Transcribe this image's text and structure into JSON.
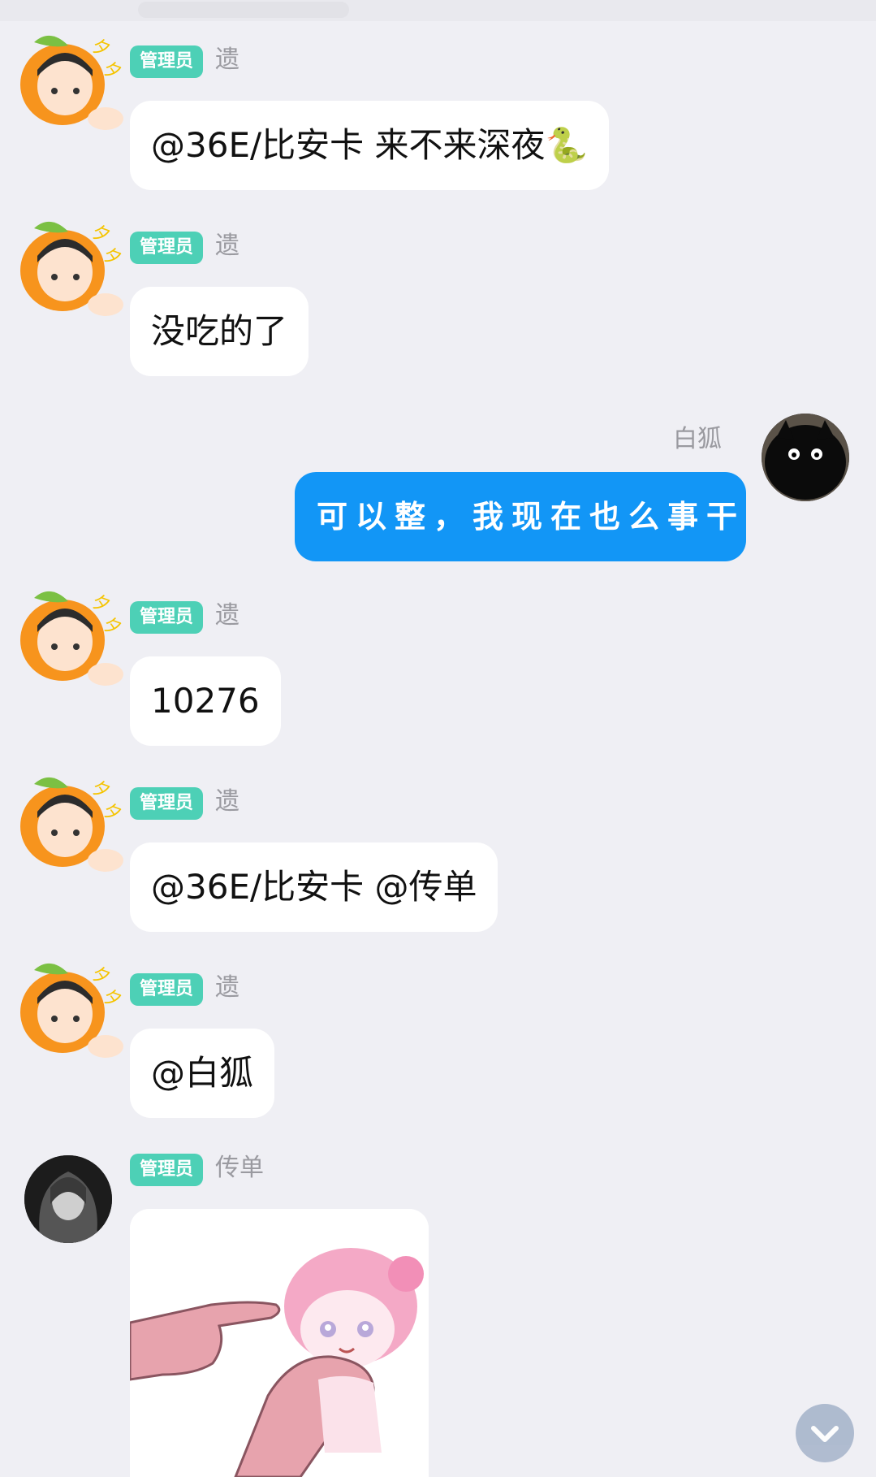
{
  "messages": [
    {
      "role": "admin",
      "badge": "管理员",
      "name": "遗",
      "text": "@36E/比安卡 来不来深夜🐍"
    },
    {
      "role": "admin",
      "badge": "管理员",
      "name": "遗",
      "text": "没吃的了"
    },
    {
      "role": "self",
      "name": "白狐",
      "text": "可以整，我现在也么事干"
    },
    {
      "role": "admin",
      "badge": "管理员",
      "name": "遗",
      "text": "10276"
    },
    {
      "role": "admin",
      "badge": "管理员",
      "name": "遗",
      "text": "@36E/比安卡 @传单"
    },
    {
      "role": "admin",
      "badge": "管理员",
      "name": "遗",
      "text": "@白狐"
    },
    {
      "role": "admin",
      "badge": "管理员",
      "name": "传单",
      "image": "sticker-finger-poke"
    }
  ],
  "icons": {
    "scroll_down": "chevron-down-icon"
  },
  "colors": {
    "badge": "#4dd0b6",
    "self_bubble": "#1296f6",
    "background": "#efeff4"
  }
}
